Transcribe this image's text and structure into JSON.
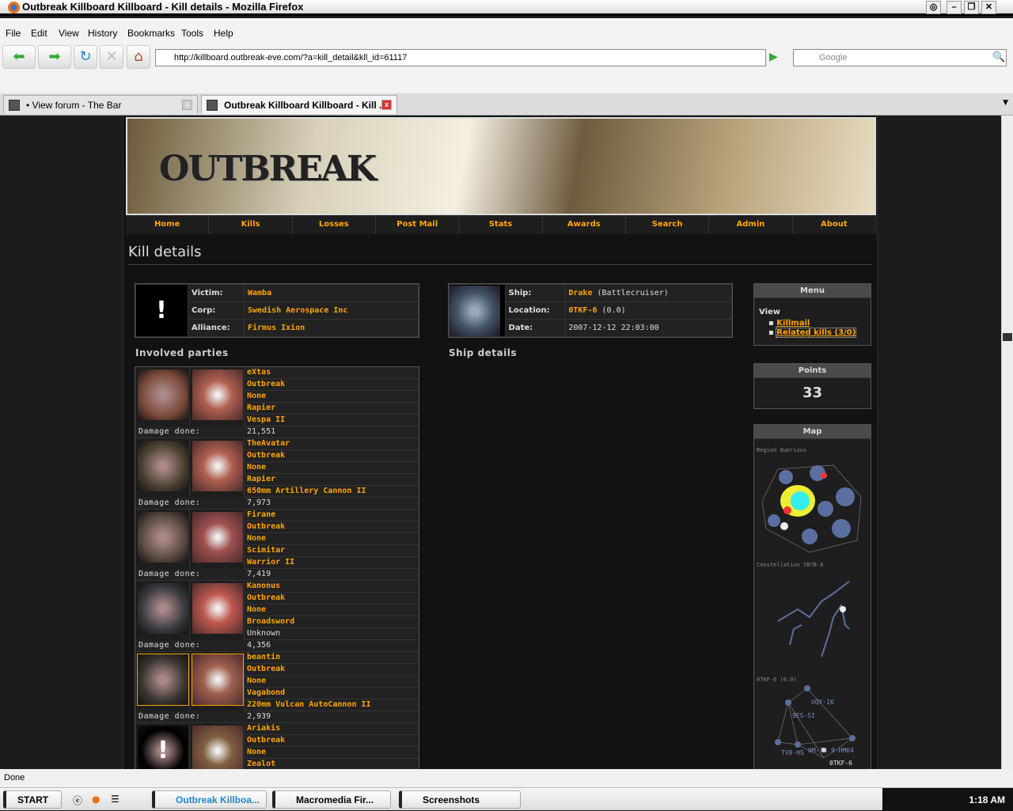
{
  "window": {
    "title": "Outbreak Killboard Killboard - Kill details - Mozilla Firefox"
  },
  "menu": [
    "File",
    "Edit",
    "View",
    "History",
    "Bookmarks",
    "Tools",
    "Help"
  ],
  "address": {
    "url": "http://killboard.outbreak-eve.com/?a=kill_detail&kll_id=61117",
    "search_placeholder": "Google"
  },
  "tabs": [
    {
      "label": "• View forum - The Bar"
    },
    {
      "label": "Outbreak Killboard Killboard - Kill ..."
    }
  ],
  "site": {
    "logo": "OUTBREAK",
    "nav": [
      "Home",
      "Kills",
      "Losses",
      "Post Mail",
      "Stats",
      "Awards",
      "Search",
      "Admin",
      "About"
    ],
    "page_title": "Kill details"
  },
  "victim": {
    "labels": {
      "victim": "Victim:",
      "corp": "Corp:",
      "alliance": "Alliance:"
    },
    "name": "Wamba",
    "corp": "Swedish Aerospace Inc",
    "alliance": "Firmus Ixion",
    "placeholder": "!"
  },
  "ship": {
    "labels": {
      "ship": "Ship:",
      "location": "Location:",
      "date": "Date:"
    },
    "name": "Drake",
    "class": "(Battlecruiser)",
    "system": "0TKF-6",
    "security": "(0.0)",
    "date": "2007-12-12 22:03:00"
  },
  "headings": {
    "involved": "Involved parties",
    "ship_details": "Ship details"
  },
  "damage_label": "Damage done:",
  "parties": [
    {
      "name": "eXtas",
      "corp": "Outbreak",
      "alliance": "None",
      "ship": "Rapier",
      "weapon": "Vespa II",
      "damage": "21,551",
      "por": "#7a4a3a",
      "shp": "#b06050"
    },
    {
      "name": "TheAvatar",
      "corp": "Outbreak",
      "alliance": "None",
      "ship": "Rapier",
      "weapon": "650mm Artillery Cannon II",
      "damage": "7,973",
      "por": "#4a4030",
      "shp": "#b06050"
    },
    {
      "name": "Firane",
      "corp": "Outbreak",
      "alliance": "None",
      "ship": "Scimitar",
      "weapon": "Warrior II",
      "damage": "7,419",
      "por": "#5a4a40",
      "shp": "#a05050"
    },
    {
      "name": "Kanonus",
      "corp": "Outbreak",
      "alliance": "None",
      "ship": "Broadsword",
      "weapon": "Unknown",
      "weapon_plain": true,
      "damage": "4,356",
      "por": "#3a3a40",
      "shp": "#c05a50"
    },
    {
      "name": "beantin",
      "corp": "Outbreak",
      "alliance": "None",
      "ship": "Vagabond",
      "weapon": "220mm Vulcan AutoCannon II",
      "damage": "2,939",
      "por": "#3a3530",
      "shp": "#a06050",
      "final": true
    },
    {
      "name": "Ariakis",
      "corp": "Outbreak",
      "alliance": "None",
      "ship": "Zealot",
      "weapon": "",
      "damage": "",
      "por": "#000",
      "shp": "#806040",
      "blank": true
    }
  ],
  "sidebar": {
    "menu_title": "Menu",
    "view_label": "View",
    "links": [
      "Killmail",
      "Related kills (3/0)"
    ],
    "points_title": "Points",
    "points": "33",
    "map_title": "Map",
    "map_region": "Region Querious",
    "map_constellation": "Constellation YB7B-8",
    "map_system": "0TKF-6 (0.0)",
    "map_systems": [
      "UQY-IK",
      "9ES-SI",
      "TV8-HS",
      "0M-TG",
      "9-HM04",
      "0TKF-6"
    ]
  },
  "status": "Done",
  "taskbar": {
    "start": "START",
    "tasks": [
      "Outbreak Killboa...",
      "Macromedia Fir...",
      "Screenshots"
    ],
    "clock": "1:18 AM"
  }
}
